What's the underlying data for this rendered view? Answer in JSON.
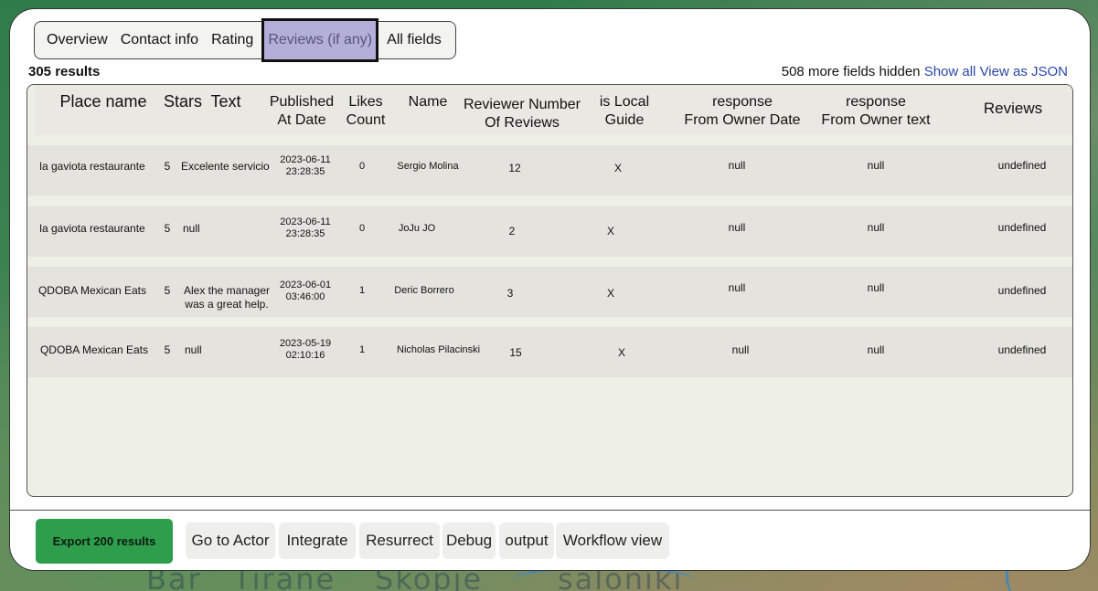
{
  "background": {
    "labels": [
      "Bar",
      "Tirane",
      "Skopje",
      "saloniki"
    ]
  },
  "tabs": [
    {
      "label": "Overview"
    },
    {
      "label": "Contact info"
    },
    {
      "label": "Rating"
    },
    {
      "label": "Reviews (if any)",
      "active": true
    },
    {
      "label": "All fields"
    }
  ],
  "results_count": "305 results",
  "hidden_fields": {
    "text": "508 more fields hidden",
    "show_all": "Show all",
    "view_json": "View as JSON"
  },
  "table": {
    "headers": {
      "place_name": "Place name",
      "stars": "Stars",
      "text": "Text",
      "published_1": "Published",
      "published_2": "At Date",
      "likes_1": "Likes",
      "likes_2": "Count",
      "name": "Name",
      "reviewer_1": "Reviewer Number",
      "reviewer_2": "Of Reviews",
      "local_1": "is Local",
      "local_2": "Guide",
      "resp_date_1": "response",
      "resp_date_2": "From Owner Date",
      "resp_text_1": "response",
      "resp_text_2": "From Owner text",
      "reviews": "Reviews"
    },
    "rows": [
      {
        "place": "la gaviota restaurante",
        "stars": "5",
        "text_1": "Excelente servicio",
        "text_2": "",
        "date_1": "2023-06-11",
        "date_2": "23:28:35",
        "likes": "0",
        "name": "Sergio Molina",
        "reviewer_count": "12",
        "local_guide": "X",
        "resp_date": "null",
        "resp_text": "null",
        "reviews": "undefined"
      },
      {
        "place": "la gaviota restaurante",
        "stars": "5",
        "text_1": "null",
        "text_2": "",
        "date_1": "2023-06-11",
        "date_2": "23:28:35",
        "likes": "0",
        "name": "JoJu JO",
        "reviewer_count": "2",
        "local_guide": "X",
        "resp_date": "null",
        "resp_text": "null",
        "reviews": "undefined"
      },
      {
        "place": "QDOBA Mexican Eats",
        "stars": "5",
        "text_1": "Alex the manager",
        "text_2": "was a great help.",
        "date_1": "2023-06-01",
        "date_2": "03:46:00",
        "likes": "1",
        "name": "Deric Borrero",
        "reviewer_count": "3",
        "local_guide": "X",
        "resp_date": "null",
        "resp_text": "null",
        "reviews": "undefined"
      },
      {
        "place": "QDOBA Mexican Eats",
        "stars": "5",
        "text_1": "null",
        "text_2": "",
        "date_1": "2023-05-19",
        "date_2": "02:10:16",
        "likes": "1",
        "name": "Nicholas Pilacinski",
        "reviewer_count": "15",
        "local_guide": "X",
        "resp_date": "null",
        "resp_text": "null",
        "reviews": "undefined"
      }
    ]
  },
  "footer": {
    "export": "Export 200 results",
    "buttons": [
      "Go to Actor",
      "Integrate",
      "Resurrect",
      "Debug",
      "output",
      "Workflow view"
    ]
  }
}
